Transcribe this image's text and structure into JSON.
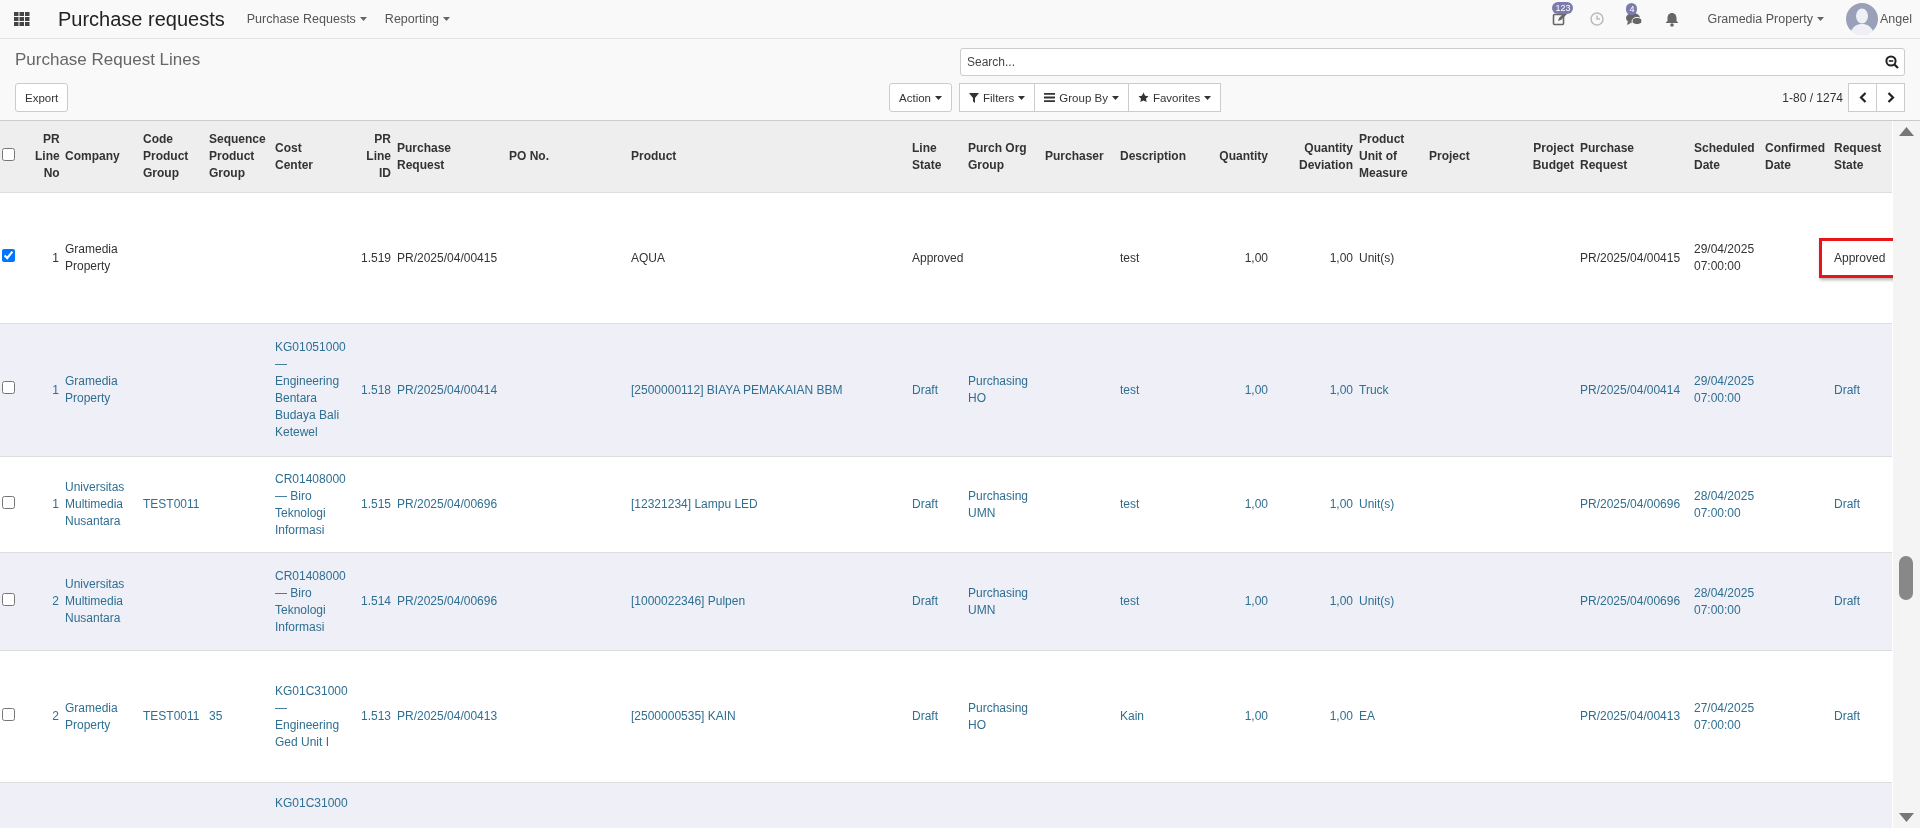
{
  "navbar": {
    "title": "Purchase requests",
    "menus": [
      {
        "label": "Purchase Requests"
      },
      {
        "label": "Reporting"
      }
    ],
    "systray": {
      "activity_count": "123",
      "message_count": "4",
      "company": "Gramedia Property",
      "user": "Angel"
    }
  },
  "control_panel": {
    "breadcrumb": "Purchase Request Lines",
    "search": {
      "placeholder": "Search..."
    },
    "export_button": "Export",
    "action_button": "Action",
    "filters": [
      {
        "label": "Filters",
        "kind": "filter"
      },
      {
        "label": "Group By",
        "kind": "group"
      },
      {
        "label": "Favorites",
        "kind": "favorite"
      }
    ],
    "pager": "1-80 / 1274"
  },
  "table": {
    "all_selected": false,
    "columns": [
      {
        "label": "PR Line No",
        "kind": "number"
      },
      {
        "label": "Company",
        "kind": "text"
      },
      {
        "label": "Code Product Group",
        "kind": "text"
      },
      {
        "label": "Sequence Product Group",
        "kind": "text"
      },
      {
        "label": "Cost Center",
        "kind": "text"
      },
      {
        "label": "PR Line ID",
        "kind": "number"
      },
      {
        "label": "Purchase Request",
        "kind": "text"
      },
      {
        "label": "PO No.",
        "kind": "text"
      },
      {
        "label": "Product",
        "kind": "text"
      },
      {
        "label": "Line State",
        "kind": "text"
      },
      {
        "label": "Purch Org Group",
        "kind": "text"
      },
      {
        "label": "Purchaser",
        "kind": "text"
      },
      {
        "label": "Description",
        "kind": "text"
      },
      {
        "label": "Quantity",
        "kind": "number"
      },
      {
        "label": "Quantity Deviation",
        "kind": "number"
      },
      {
        "label": "Product Unit of Measure",
        "kind": "text"
      },
      {
        "label": "Project",
        "kind": "text"
      },
      {
        "label": "Project Budget",
        "kind": "number"
      },
      {
        "label": "Purchase Request",
        "kind": "text"
      },
      {
        "label": "Scheduled Date",
        "kind": "text"
      },
      {
        "label": "Confirmed Date",
        "kind": "text"
      },
      {
        "label": "Request State",
        "kind": "text"
      }
    ],
    "rows": [
      {
        "selected": true,
        "kind": "approved",
        "state_highlighted": true,
        "cells": [
          "1",
          "Gramedia Property",
          null,
          null,
          null,
          "1.519",
          "PR/2025/04/00415",
          null,
          "AQUA",
          "Approved",
          null,
          null,
          "test",
          "1,00",
          "1,00",
          "Unit(s)",
          null,
          null,
          "PR/2025/04/00415",
          "29/04/2025 07:00:00",
          null,
          "Approved"
        ]
      },
      {
        "selected": false,
        "kind": "draft",
        "state_highlighted": false,
        "cells": [
          "1",
          "Gramedia Property",
          null,
          null,
          "KG01051000 — Engineering Bentara Budaya Bali Ketewel",
          "1.518",
          "PR/2025/04/00414",
          null,
          "[2500000112] BIAYA PEMAKAIAN BBM",
          "Draft",
          "Purchasing HO",
          null,
          "test",
          "1,00",
          "1,00",
          "Truck",
          null,
          null,
          "PR/2025/04/00414",
          "29/04/2025 07:00:00",
          null,
          "Draft"
        ]
      },
      {
        "selected": false,
        "kind": "draft",
        "state_highlighted": false,
        "cells": [
          "1",
          "Universitas Multimedia Nusantara",
          "TEST0011",
          null,
          "CR01408000 — Biro Teknologi Informasi",
          "1.515",
          "PR/2025/04/00696",
          null,
          "[12321234] Lampu LED",
          "Draft",
          "Purchasing UMN",
          null,
          "test",
          "1,00",
          "1,00",
          "Unit(s)",
          null,
          null,
          "PR/2025/04/00696",
          "28/04/2025 07:00:00",
          null,
          "Draft"
        ]
      },
      {
        "selected": false,
        "kind": "draft",
        "state_highlighted": false,
        "cells": [
          "2",
          "Universitas Multimedia Nusantara",
          null,
          null,
          "CR01408000 — Biro Teknologi Informasi",
          "1.514",
          "PR/2025/04/00696",
          null,
          "[1000022346] Pulpen",
          "Draft",
          "Purchasing UMN",
          null,
          "test",
          "1,00",
          "1,00",
          "Unit(s)",
          null,
          null,
          "PR/2025/04/00696",
          "28/04/2025 07:00:00",
          null,
          "Draft"
        ]
      },
      {
        "selected": false,
        "kind": "draft",
        "state_highlighted": false,
        "cells": [
          "2",
          "Gramedia Property",
          "TEST0011",
          "35",
          "KG01C31000 — Engineering Ged Unit I",
          "1.513",
          "PR/2025/04/00413",
          null,
          "[2500000535] KAIN",
          "Draft",
          "Purchasing HO",
          null,
          "Kain",
          "1,00",
          "1,00",
          "EA",
          null,
          null,
          "PR/2025/04/00413",
          "27/04/2025 07:00:00",
          null,
          "Draft"
        ]
      },
      {
        "partial": true,
        "kind": "draft",
        "cells": [
          null,
          null,
          null,
          null,
          "KG01C31000",
          null,
          null,
          null,
          null,
          null,
          null,
          null,
          null,
          null,
          null,
          null,
          null,
          null,
          null,
          null,
          null,
          null
        ]
      }
    ]
  }
}
